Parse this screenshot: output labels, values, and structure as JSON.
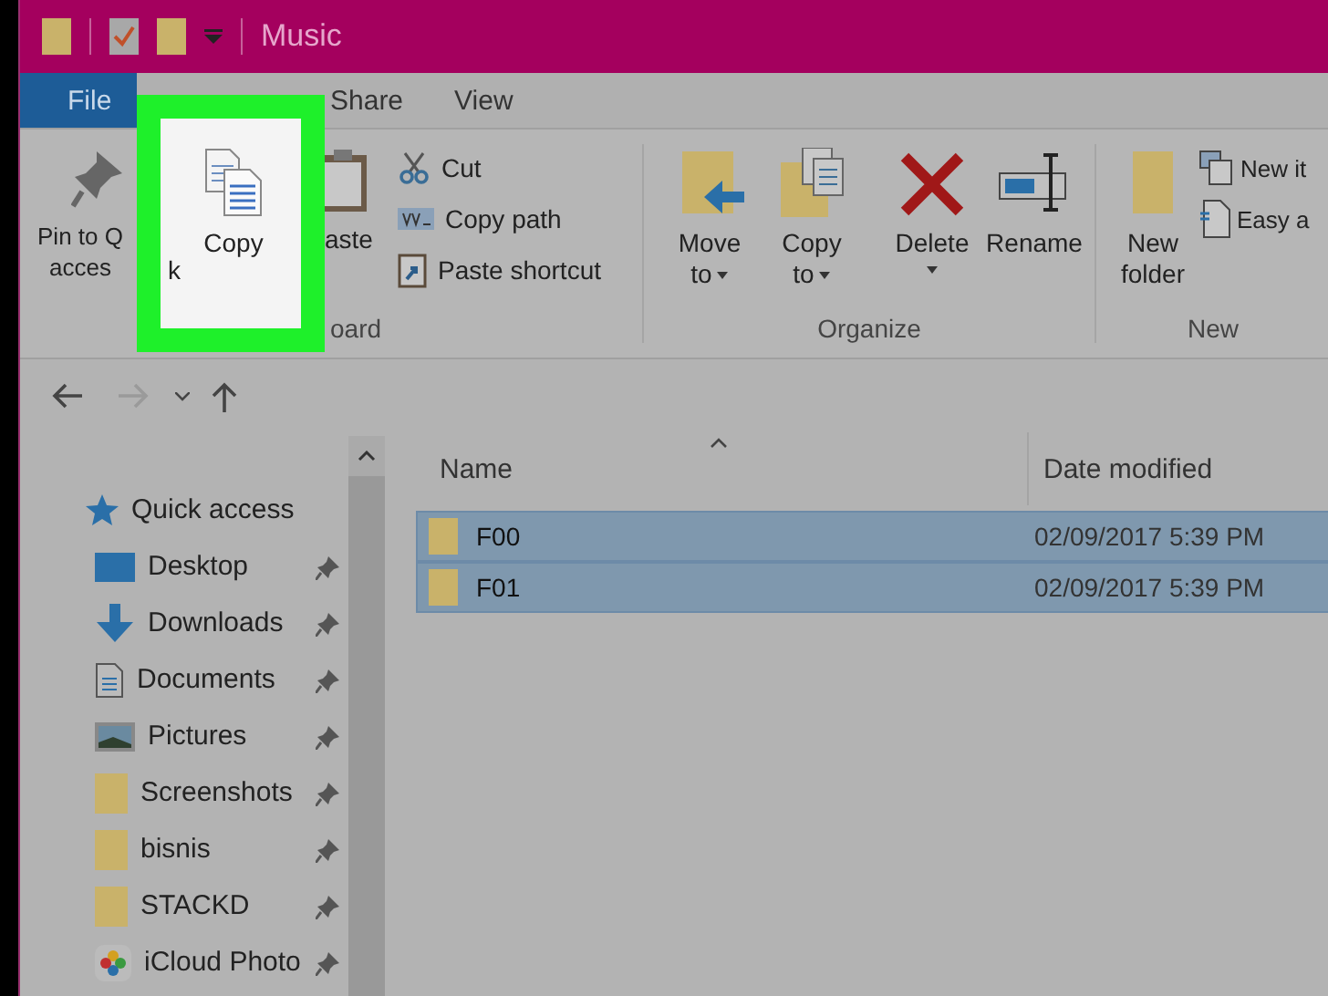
{
  "title_bar": {
    "title": "Music"
  },
  "tabs": [
    {
      "label": "File",
      "kind": "file",
      "selected": false
    },
    {
      "label": "Share",
      "kind": "tab",
      "selected": false
    },
    {
      "label": "View",
      "kind": "tab",
      "selected": false
    }
  ],
  "ribbon": {
    "clipboard": {
      "pin_lines": [
        "Pin to Q",
        "acces"
      ],
      "highlight_fragment": "k",
      "copy": "Copy",
      "paste": "aste",
      "small_buttons": [
        "Cut",
        "Copy path",
        "Paste shortcut"
      ],
      "group_label": "oard"
    },
    "organize": {
      "buttons": [
        {
          "lines": [
            "Move",
            "to"
          ],
          "dropdown": true
        },
        {
          "lines": [
            "Copy",
            "to"
          ],
          "dropdown": true
        },
        {
          "lines": [
            "Delete"
          ],
          "dropdown": true
        },
        {
          "lines": [
            "Rename"
          ],
          "dropdown": false
        }
      ],
      "group_label": "Organize"
    },
    "new": {
      "new_folder": [
        "New",
        "folder"
      ],
      "small_buttons": [
        "New it",
        "Easy a"
      ],
      "group_label": "New"
    }
  },
  "nav": {
    "forward_disabled": true
  },
  "sidebar": {
    "items": [
      {
        "label": "Quick access",
        "kind": "star",
        "pinned": false
      },
      {
        "label": "Desktop",
        "kind": "desktop",
        "pinned": true
      },
      {
        "label": "Downloads",
        "kind": "download",
        "pinned": true
      },
      {
        "label": "Documents",
        "kind": "document",
        "pinned": true
      },
      {
        "label": "Pictures",
        "kind": "picture",
        "pinned": true
      },
      {
        "label": "Screenshots",
        "kind": "folder",
        "pinned": true
      },
      {
        "label": "bisnis",
        "kind": "folder",
        "pinned": true
      },
      {
        "label": "STACKD",
        "kind": "folder",
        "pinned": true
      },
      {
        "label": "iCloud Photo",
        "kind": "photos",
        "pinned": true
      }
    ]
  },
  "file_list": {
    "columns": [
      "Name",
      "Date modified"
    ],
    "rows": [
      {
        "name": "F00",
        "date": "02/09/2017 5:39 PM",
        "selected": true
      },
      {
        "name": "F01",
        "date": "02/09/2017 5:39 PM",
        "selected": true
      }
    ]
  }
}
